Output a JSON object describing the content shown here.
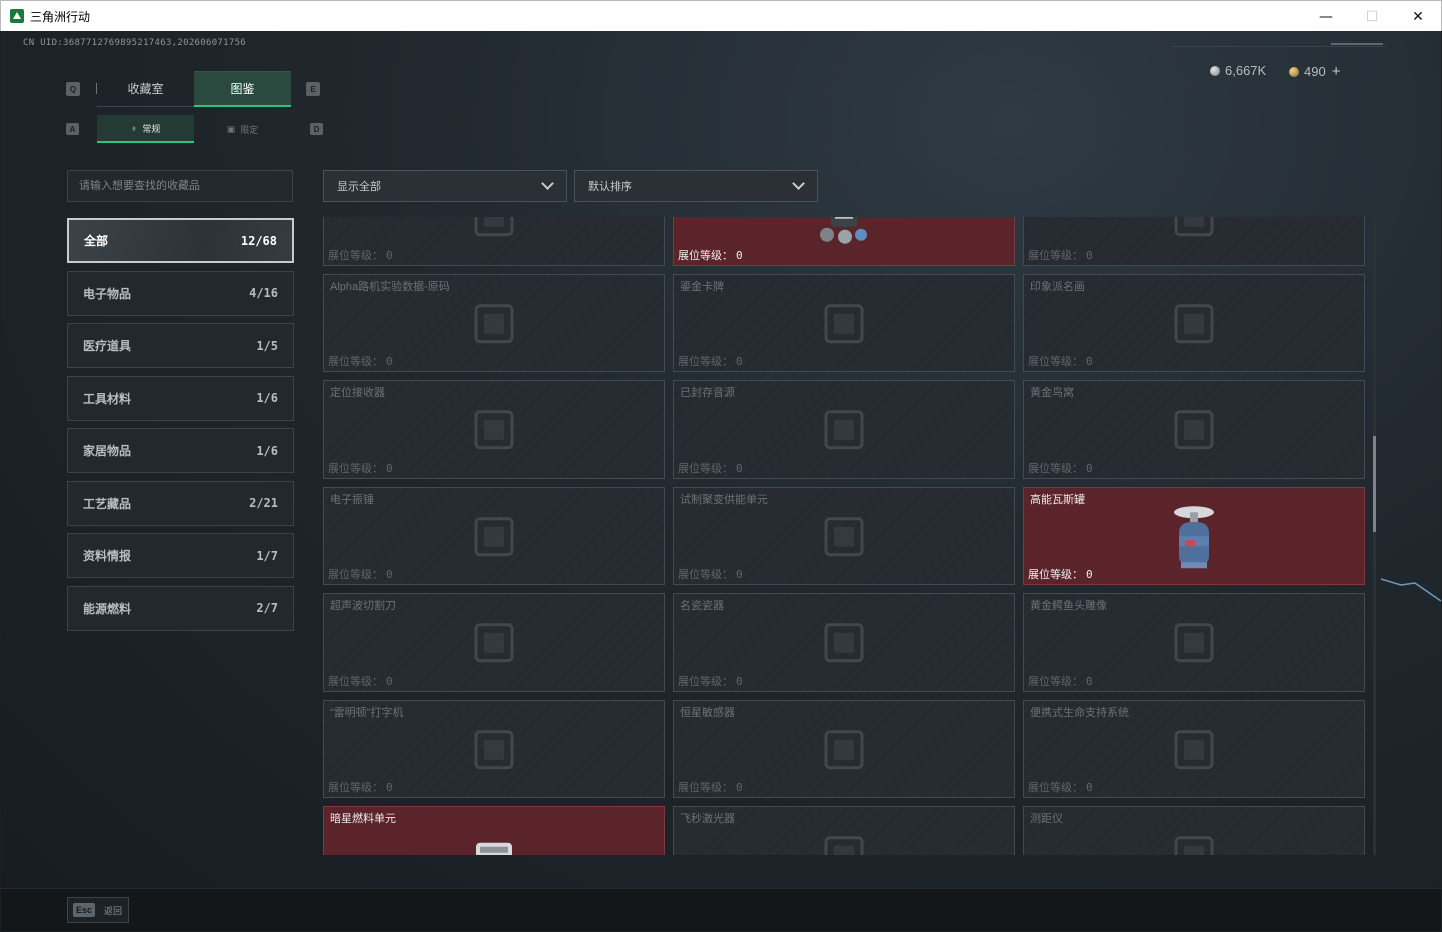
{
  "window": {
    "title": "三角洲行动",
    "minimize_icon": "—",
    "maximize_icon": "☐",
    "close_icon": "✕"
  },
  "header": {
    "uid": "CN UID:3687712769895217463,202606071756",
    "currency": [
      {
        "icon": "silver-coin-icon",
        "value": "6,667K"
      },
      {
        "icon": "gold-coin-icon",
        "value": "490"
      }
    ],
    "plus": "+"
  },
  "keyhints": {
    "left_main": "Q",
    "right_main": "E",
    "left_sub": "A",
    "right_sub": "D"
  },
  "main_tabs": [
    {
      "label": "收藏室",
      "active": false
    },
    {
      "label": "图鉴",
      "active": true
    }
  ],
  "sub_tabs": [
    {
      "label": "常规",
      "icon": "flask-icon",
      "active": true
    },
    {
      "label": "限定",
      "icon": "image-icon",
      "active": false
    }
  ],
  "search": {
    "placeholder": "请输入想要查找的收藏品",
    "value": ""
  },
  "categories": [
    {
      "label": "全部",
      "count": "12/68",
      "active": true
    },
    {
      "label": "电子物品",
      "count": "4/16"
    },
    {
      "label": "医疗道具",
      "count": "1/5"
    },
    {
      "label": "工具材料",
      "count": "1/6"
    },
    {
      "label": "家居物品",
      "count": "1/6"
    },
    {
      "label": "工艺藏品",
      "count": "2/21"
    },
    {
      "label": "资料情报",
      "count": "1/7"
    },
    {
      "label": "能源燃料",
      "count": "2/7"
    }
  ],
  "filters": {
    "show": "显示全部",
    "sort": "默认排序"
  },
  "level_label": "展位等级：",
  "items": [
    {
      "name": "",
      "level": "0",
      "owned": false,
      "icon": "rope-icon"
    },
    {
      "name": "",
      "level": "0",
      "owned": true,
      "icon": "device-icon"
    },
    {
      "name": "",
      "level": "0",
      "owned": false,
      "icon": "box-icon"
    },
    {
      "name": "Alpha路机实验数据-原码",
      "level": "0",
      "owned": false,
      "icon": "drive-icon"
    },
    {
      "name": "鎏金卡牌",
      "level": "0",
      "owned": false,
      "icon": "card-icon"
    },
    {
      "name": "印象派名画",
      "level": "0",
      "owned": false,
      "icon": "frame-icon"
    },
    {
      "name": "定位接收器",
      "level": "0",
      "owned": false,
      "icon": "chip-icon"
    },
    {
      "name": "已封存音源",
      "level": "0",
      "owned": false,
      "icon": "speaker-icon"
    },
    {
      "name": "黄金鸟窝",
      "level": "0",
      "owned": false,
      "icon": "nest-icon"
    },
    {
      "name": "电子振锤",
      "level": "0",
      "owned": false,
      "icon": "hammer-icon"
    },
    {
      "name": "试制聚变供能单元",
      "level": "0",
      "owned": false,
      "icon": "fusion-cell-icon"
    },
    {
      "name": "高能瓦斯罐",
      "level": "0",
      "owned": true,
      "icon": "gas-canister-icon"
    },
    {
      "name": "超声波切割刀",
      "level": "0",
      "owned": false,
      "icon": "knife-icon"
    },
    {
      "name": "名瓷瓷器",
      "level": "0",
      "owned": false,
      "icon": "vase-icon"
    },
    {
      "name": "黄金鳄鱼头雕像",
      "level": "0",
      "owned": false,
      "icon": "statue-icon"
    },
    {
      "name": "“雷明顿”打字机",
      "level": "0",
      "owned": false,
      "icon": "typewriter-icon"
    },
    {
      "name": "恒星敏感器",
      "level": "0",
      "owned": false,
      "icon": "sensor-icon"
    },
    {
      "name": "便携式生命支持系统",
      "level": "0",
      "owned": false,
      "icon": "life-support-icon"
    },
    {
      "name": "暗星燃料单元",
      "level": "",
      "owned": true,
      "icon": "fuel-cell-icon"
    },
    {
      "name": "飞秒激光器",
      "level": "",
      "owned": false,
      "icon": "laser-icon"
    },
    {
      "name": "测距仪",
      "level": "",
      "owned": false,
      "icon": "rangefinder-icon"
    }
  ],
  "footer": {
    "esc": "Esc",
    "back": "返回"
  },
  "colors": {
    "accent": "#29c77e",
    "owned_bg": "#5a242a"
  }
}
